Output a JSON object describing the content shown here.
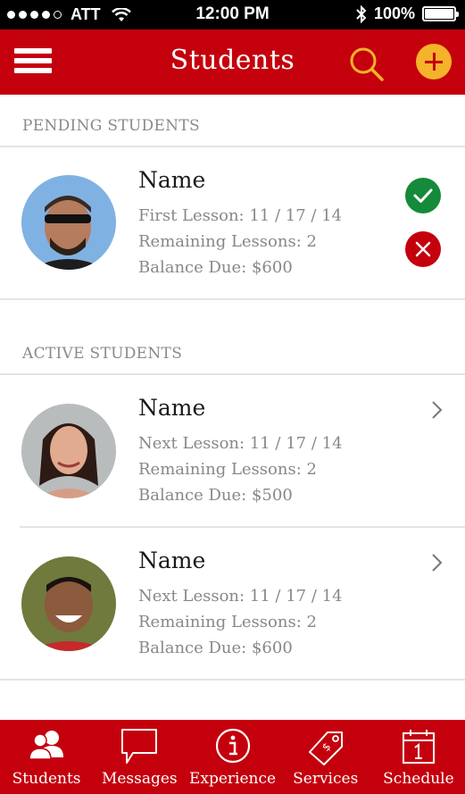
{
  "status_bar": {
    "carrier": "ATT",
    "time": "12:00 PM",
    "battery": "100%",
    "battery_level": 1.0
  },
  "header": {
    "title": "Students",
    "menu_icon": "hamburger-menu-icon",
    "search_icon": "search-icon",
    "add_icon": "plus-icon"
  },
  "sections": {
    "pending_label": "PENDING STUDENTS",
    "active_label": "ACTIVE STUDENTS"
  },
  "pending_students": [
    {
      "name": "Name",
      "line1": "First Lesson: 11 / 17 / 14",
      "line2": "Remaining Lessons: 2",
      "line3": "Balance Due: $600"
    }
  ],
  "active_students": [
    {
      "name": "Name",
      "line1": "Next Lesson: 11 / 17 / 14",
      "line2": "Remaining Lessons: 2",
      "line3": "Balance Due: $500"
    },
    {
      "name": "Name",
      "line1": "Next Lesson: 11 / 17 / 14",
      "line2": "Remaining Lessons: 2",
      "line3": "Balance Due: $600"
    }
  ],
  "tabs": [
    {
      "label": "Students",
      "icon": "students-icon"
    },
    {
      "label": "Messages",
      "icon": "message-bubble-icon"
    },
    {
      "label": "Experience",
      "icon": "info-icon"
    },
    {
      "label": "Services",
      "icon": "price-tag-icon"
    },
    {
      "label": "Schedule",
      "icon": "calendar-icon"
    }
  ],
  "colors": {
    "brand_red": "#c4000d",
    "accent_yellow": "#f4b32a",
    "approve_green": "#158a3a",
    "muted_text": "#888888"
  }
}
